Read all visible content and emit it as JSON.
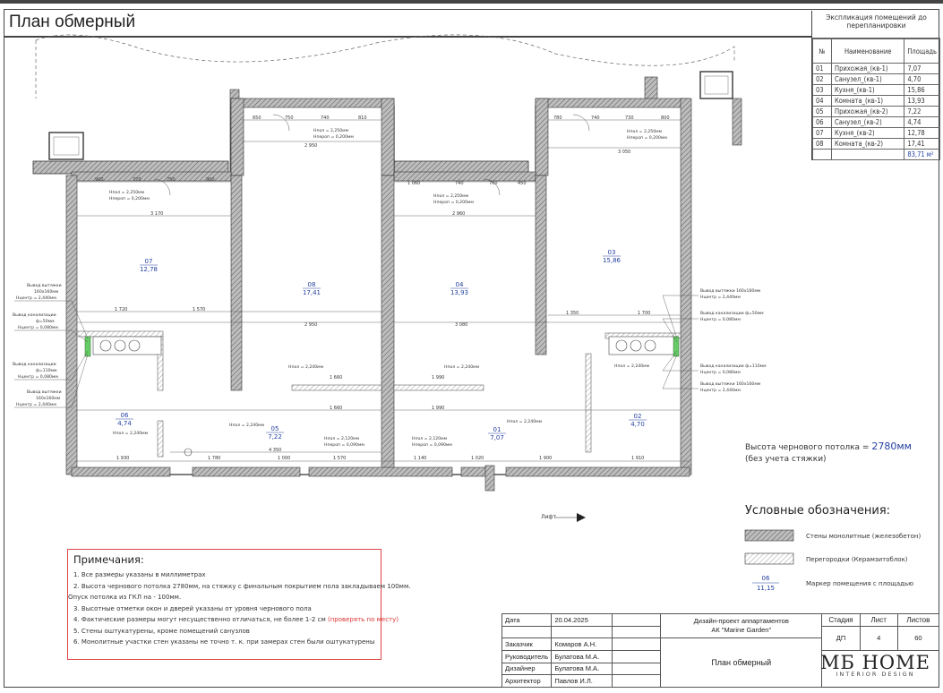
{
  "page_title": "План обмерный",
  "explication": {
    "caption": "Экспликация помещений до перепланировки",
    "columns": [
      "№",
      "Наименование",
      "Площадь"
    ],
    "rows": [
      [
        "01",
        "Прихожая_(кв-1)",
        "7,07"
      ],
      [
        "02",
        "Санузел_(кв-1)",
        "4,70"
      ],
      [
        "03",
        "Кухня_(кв-1)",
        "15,86"
      ],
      [
        "04",
        "Комната_(кв-1)",
        "13,93"
      ],
      [
        "05",
        "Прихожая_(кв-2)",
        "7,22"
      ],
      [
        "06",
        "Санузел_(кв-2)",
        "4,74"
      ],
      [
        "07",
        "Кухня_(кв-2)",
        "12,78"
      ],
      [
        "08",
        "Комната_(кв-2)",
        "17,41"
      ]
    ],
    "total": "83,71 м²"
  },
  "rooms": [
    {
      "num": "07",
      "area": "12,78"
    },
    {
      "num": "08",
      "area": "17,41"
    },
    {
      "num": "04",
      "area": "13,93"
    },
    {
      "num": "03",
      "area": "15,86"
    },
    {
      "num": "06",
      "area": "4,74"
    },
    {
      "num": "05",
      "area": "7,22"
    },
    {
      "num": "01",
      "area": "7,07"
    },
    {
      "num": "02",
      "area": "4,70"
    }
  ],
  "dims": {
    "d650": "650",
    "d750": "750",
    "d740": "740",
    "d810": "810",
    "d2950": "2 950",
    "d780": "780",
    "d740b": "740",
    "d730": "730",
    "d800": "800",
    "d3050": "3 050",
    "d900": "900",
    "d720": "720",
    "d750b": "750",
    "d900b": "900",
    "d3170": "3 170",
    "d1060": "1 060",
    "d740c": "740",
    "d760": "760",
    "d450": "450",
    "d2960": "2 960",
    "d1720": "1 720",
    "d1570": "1 570",
    "d2950b": "2 950",
    "d3080": "3 080",
    "d1350": "1 350",
    "d1700": "1 700",
    "d1930": "1 930",
    "d1780": "1 780",
    "d1000": "1 000",
    "d1570b": "1 570",
    "d1140": "1 140",
    "d1020": "1 020",
    "d1900": "1 900",
    "d1910": "1 910",
    "d4350": "4 350",
    "d1660": "1 660",
    "d1990": "1 990",
    "d1660b": "1 660",
    "d1990b": "1 990"
  },
  "heights": {
    "h1": "Нпол = 2,250мм",
    "h1b": "Нпероп = 0,200мм",
    "h2": "Нпол = 2,250мм",
    "h2b": "Нпероп = 0,200мм",
    "h3": "Нпол = 2,250мм",
    "h3b": "Нпероп = 0,200мм",
    "h4": "Нпол = 2,250мм",
    "h4b": "Нпероп = 0,200мм",
    "h5": "Нпол = 2,240мм",
    "h6": "Нпол = 2,240мм",
    "h7": "Нпол = 2,240мм",
    "h8": "Нпол = 2,240мм",
    "h9": "Нпол = 2,240мм",
    "h10": "Нпол = 2,240мм",
    "h11": "Нпол = 2,120мм",
    "h11b": "Нпероп = 0,090мм",
    "h12": "Нпол = 2,120мм",
    "h12b": "Нпероп = 0,090мм"
  },
  "callouts_left": {
    "c1a": "Вывод вытяжки",
    "c1b": "160х160мм",
    "c1c": "Нцентр = 2,440мм",
    "c2a": "Вывод канализации",
    "c2b": "ф=50мм",
    "c2c": "Нцентр = 0,080мм",
    "c3a": "Вывод канализации",
    "c3b": "ф=110мм",
    "c3c": "Нцентр = 0,080мм",
    "c4a": "Вывод вытяжки",
    "c4b": "160х160мм",
    "c4c": "Нцентр = 2,440мм"
  },
  "callouts_right": {
    "c1a": "Вывод вытяжки 160х160мм",
    "c1b": "Нцентр = 2,440мм",
    "c2a": "Вывод канализации ф=50мм",
    "c2b": "Нцентр = 0,080мм",
    "c3a": "Вывод канализации ф=110мм",
    "c3b": "Нцентр = 0,080мм",
    "c4a": "Вывод вытяжки 160х160мм",
    "c4b": "Нцентр = 2,440мм"
  },
  "lift_label": "Лифт",
  "ceiling_note": {
    "prefix": "Высота чернового потолка = ",
    "value": "2780мм",
    "suffix": "(без учета стяжки)"
  },
  "legend": {
    "title": "Условные обозначения:",
    "walls": "Стены монолитные (железобетон)",
    "partitions": "Перегородки (Керамзитоблок)",
    "marker_num": "06",
    "marker_area": "11,15",
    "marker_desc": "Маркер помещения с площадью"
  },
  "notes": {
    "title": "Примечания:",
    "n1": "1. Все размеры указаны в миллиметрах",
    "n2": "2. Высота чернового потолка 2780мм, на стяжку с финальным покрытием пола закладываем 100мм.",
    "n2b": "Опуск потолка из ГКЛ на - 100мм.",
    "n3": "3. Высотные отметки окон и дверей указаны от уровня чернового пола",
    "n4": "4. Фактические размеры могут несущественно отличаться, не более 1-2 см",
    "n4red": "(проверять по месту)",
    "n5": "5. Стены оштукатурены, кроме помещений санузлов",
    "n6": "6. Монолитные участки стен указаны не точно т. к. при замерах стен были оштукатурены"
  },
  "stamp": {
    "date_label": "Дата",
    "date_value": "20.04.2025",
    "client_label": "Заказчик",
    "client_value": "Комаров А.Н.",
    "lead_label": "Руководитель",
    "lead_value": "Булатова М.А.",
    "designer_label": "Дизайнер",
    "designer_value": "Булатова М.А.",
    "architect_label": "Архитектор",
    "architect_value": "Павлов И.Л.",
    "project_line1": "Дизайн-проект аппартаментов",
    "project_line2": "АК \"Marine Garden\"",
    "sheet_title": "План обмерный",
    "stage_label": "Стадия",
    "stage_value": "ДП",
    "sheet_label": "Лист",
    "sheet_value": "4",
    "sheets_label": "Листов",
    "sheets_value": "60",
    "logo_main": "МБ HOME",
    "logo_sub": "INTERIOR DESIGN"
  }
}
